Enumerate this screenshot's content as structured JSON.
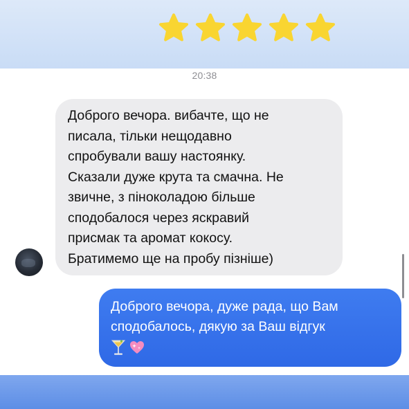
{
  "rating": {
    "stars": 5,
    "max": 5,
    "color": "#f9d531"
  },
  "timestamp": "20:38",
  "messages": {
    "incoming": {
      "lines": [
        "Доброго вечора. вибачте, що не",
        "писала, тільки нещодавно",
        "спробували вашу настоянку.",
        "Сказали дуже крута та смачна. Не",
        "звичне, з піноколадою більше",
        "сподобалося через яскравий",
        "присмак та аромат кокосу.",
        "Братимемо ще на пробу пізніше)"
      ],
      "bubble_color": "#ececee"
    },
    "outgoing": {
      "lines": [
        "Доброго вечора, дуже рада, що Вам",
        "сподобалось, дякую за Ваш відгук"
      ],
      "emojis": [
        "cocktail-icon",
        "sparkling-heart-icon"
      ],
      "bubble_color": "#2f69e6"
    }
  }
}
